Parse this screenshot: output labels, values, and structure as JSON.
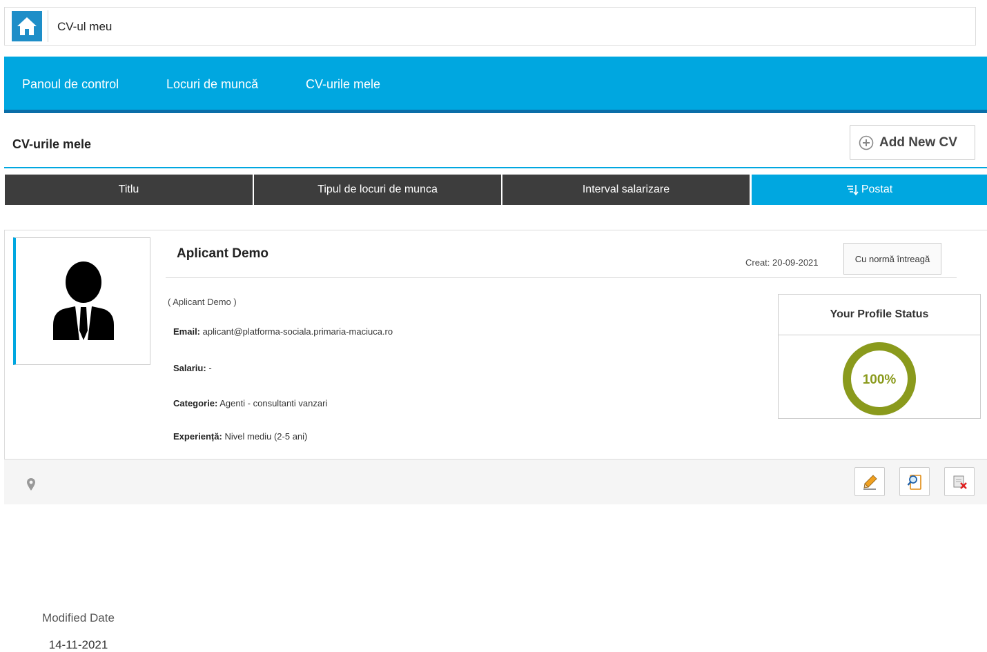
{
  "breadcrumb": {
    "text": "CV-ul meu"
  },
  "nav": {
    "items": [
      "Panoul de control",
      "Locuri de muncă",
      "CV-urile mele"
    ]
  },
  "section": {
    "title": "CV-urile mele",
    "add_button": "Add New CV"
  },
  "table_header": {
    "columns": [
      "Titlu",
      "Tipul de locuri de munca",
      "Interval salarizare",
      "Postat"
    ],
    "active_column": 3
  },
  "cv": {
    "name": "Aplicant Demo",
    "subtitle": "( Aplicant Demo )",
    "created": "Creat: 20-09-2021",
    "job_type": "Cu normă întreagă",
    "modified_label": "Modified Date",
    "modified_date": "14-11-2021",
    "fields": [
      {
        "label": "Email:",
        "value": "aplicant@platforma-sociala.primaria-maciuca.ro"
      },
      {
        "label": "Salariu:",
        "value": "-"
      },
      {
        "label": "Categorie:",
        "value": "Agenti - consultanti vanzari"
      },
      {
        "label": "Experiență:",
        "value": "Nivel mediu (2-5 ani)"
      }
    ],
    "profile_status": {
      "title": "Your Profile Status",
      "percent_label": "100%",
      "percent": 100
    }
  },
  "colors": {
    "accent": "#00a7e0",
    "header_dark": "#3d3d3d",
    "ring": "#8a9a1c"
  },
  "icons": [
    "home-icon",
    "plus-circle-icon",
    "sort-icon",
    "user-silhouette-icon",
    "map-pin-icon",
    "pencil-icon",
    "view-document-icon",
    "delete-document-icon"
  ]
}
